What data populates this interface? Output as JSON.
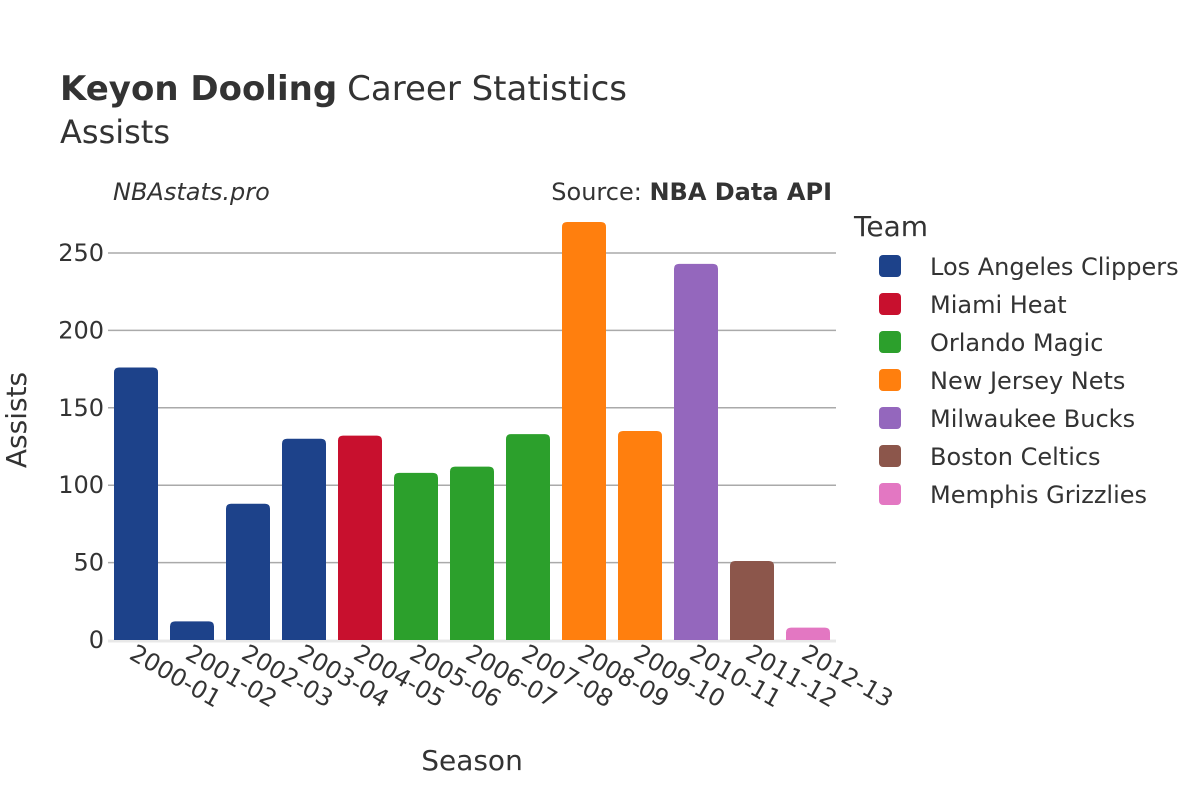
{
  "header": {
    "player_name": "Keyon Dooling",
    "title_suffix": "Career Statistics",
    "stat": "Assists",
    "brand": "NBAstats.pro",
    "source_label": "Source: ",
    "source_name": "NBA Data API"
  },
  "chart_data": {
    "type": "bar",
    "title": "Keyon Dooling Career Statistics",
    "subtitle": "Assists",
    "xlabel": "Season",
    "ylabel": "Assists",
    "ylim": [
      0,
      280
    ],
    "yticks": [
      0,
      50,
      100,
      150,
      200,
      250
    ],
    "grid": true,
    "legend_title": "Team",
    "legend_position": "right",
    "categories": [
      "2000-01",
      "2001-02",
      "2002-03",
      "2003-04",
      "2004-05",
      "2005-06",
      "2006-07",
      "2007-08",
      "2008-09",
      "2009-10",
      "2010-11",
      "2011-12",
      "2012-13"
    ],
    "values": [
      176,
      12,
      88,
      130,
      132,
      108,
      112,
      133,
      270,
      135,
      243,
      51,
      8
    ],
    "bar_teams": [
      "Los Angeles Clippers",
      "Los Angeles Clippers",
      "Los Angeles Clippers",
      "Los Angeles Clippers",
      "Miami Heat",
      "Orlando Magic",
      "Orlando Magic",
      "Orlando Magic",
      "New Jersey Nets",
      "New Jersey Nets",
      "Milwaukee Bucks",
      "Boston Celtics",
      "Memphis Grizzlies"
    ],
    "teams": [
      {
        "name": "Los Angeles Clippers",
        "color": "#1d428a"
      },
      {
        "name": "Miami Heat",
        "color": "#c8102e"
      },
      {
        "name": "Orlando Magic",
        "color": "#2ca02c"
      },
      {
        "name": "New Jersey Nets",
        "color": "#ff7f0e"
      },
      {
        "name": "Milwaukee Bucks",
        "color": "#9467bd"
      },
      {
        "name": "Boston Celtics",
        "color": "#8c564b"
      },
      {
        "name": "Memphis Grizzlies",
        "color": "#e377c2"
      }
    ]
  }
}
